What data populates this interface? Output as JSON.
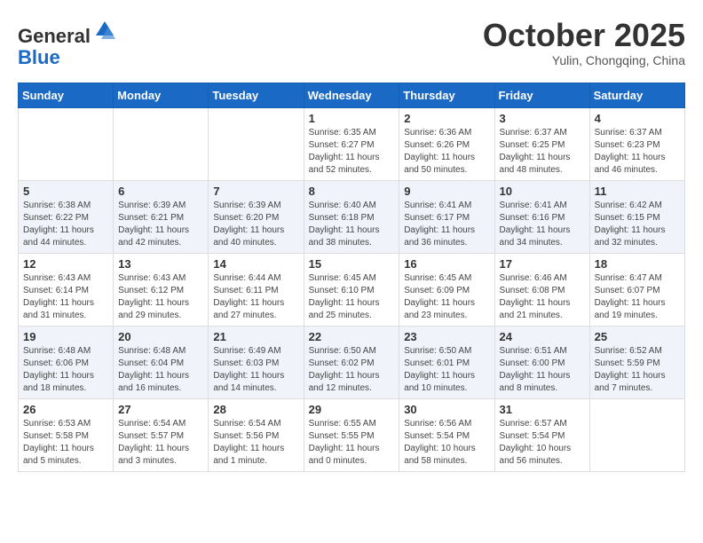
{
  "header": {
    "logo_line1": "General",
    "logo_line2": "Blue",
    "month": "October 2025",
    "location": "Yulin, Chongqing, China"
  },
  "weekdays": [
    "Sunday",
    "Monday",
    "Tuesday",
    "Wednesday",
    "Thursday",
    "Friday",
    "Saturday"
  ],
  "weeks": [
    [
      {
        "day": "",
        "info": ""
      },
      {
        "day": "",
        "info": ""
      },
      {
        "day": "",
        "info": ""
      },
      {
        "day": "1",
        "info": "Sunrise: 6:35 AM\nSunset: 6:27 PM\nDaylight: 11 hours\nand 52 minutes."
      },
      {
        "day": "2",
        "info": "Sunrise: 6:36 AM\nSunset: 6:26 PM\nDaylight: 11 hours\nand 50 minutes."
      },
      {
        "day": "3",
        "info": "Sunrise: 6:37 AM\nSunset: 6:25 PM\nDaylight: 11 hours\nand 48 minutes."
      },
      {
        "day": "4",
        "info": "Sunrise: 6:37 AM\nSunset: 6:23 PM\nDaylight: 11 hours\nand 46 minutes."
      }
    ],
    [
      {
        "day": "5",
        "info": "Sunrise: 6:38 AM\nSunset: 6:22 PM\nDaylight: 11 hours\nand 44 minutes."
      },
      {
        "day": "6",
        "info": "Sunrise: 6:39 AM\nSunset: 6:21 PM\nDaylight: 11 hours\nand 42 minutes."
      },
      {
        "day": "7",
        "info": "Sunrise: 6:39 AM\nSunset: 6:20 PM\nDaylight: 11 hours\nand 40 minutes."
      },
      {
        "day": "8",
        "info": "Sunrise: 6:40 AM\nSunset: 6:18 PM\nDaylight: 11 hours\nand 38 minutes."
      },
      {
        "day": "9",
        "info": "Sunrise: 6:41 AM\nSunset: 6:17 PM\nDaylight: 11 hours\nand 36 minutes."
      },
      {
        "day": "10",
        "info": "Sunrise: 6:41 AM\nSunset: 6:16 PM\nDaylight: 11 hours\nand 34 minutes."
      },
      {
        "day": "11",
        "info": "Sunrise: 6:42 AM\nSunset: 6:15 PM\nDaylight: 11 hours\nand 32 minutes."
      }
    ],
    [
      {
        "day": "12",
        "info": "Sunrise: 6:43 AM\nSunset: 6:14 PM\nDaylight: 11 hours\nand 31 minutes."
      },
      {
        "day": "13",
        "info": "Sunrise: 6:43 AM\nSunset: 6:12 PM\nDaylight: 11 hours\nand 29 minutes."
      },
      {
        "day": "14",
        "info": "Sunrise: 6:44 AM\nSunset: 6:11 PM\nDaylight: 11 hours\nand 27 minutes."
      },
      {
        "day": "15",
        "info": "Sunrise: 6:45 AM\nSunset: 6:10 PM\nDaylight: 11 hours\nand 25 minutes."
      },
      {
        "day": "16",
        "info": "Sunrise: 6:45 AM\nSunset: 6:09 PM\nDaylight: 11 hours\nand 23 minutes."
      },
      {
        "day": "17",
        "info": "Sunrise: 6:46 AM\nSunset: 6:08 PM\nDaylight: 11 hours\nand 21 minutes."
      },
      {
        "day": "18",
        "info": "Sunrise: 6:47 AM\nSunset: 6:07 PM\nDaylight: 11 hours\nand 19 minutes."
      }
    ],
    [
      {
        "day": "19",
        "info": "Sunrise: 6:48 AM\nSunset: 6:06 PM\nDaylight: 11 hours\nand 18 minutes."
      },
      {
        "day": "20",
        "info": "Sunrise: 6:48 AM\nSunset: 6:04 PM\nDaylight: 11 hours\nand 16 minutes."
      },
      {
        "day": "21",
        "info": "Sunrise: 6:49 AM\nSunset: 6:03 PM\nDaylight: 11 hours\nand 14 minutes."
      },
      {
        "day": "22",
        "info": "Sunrise: 6:50 AM\nSunset: 6:02 PM\nDaylight: 11 hours\nand 12 minutes."
      },
      {
        "day": "23",
        "info": "Sunrise: 6:50 AM\nSunset: 6:01 PM\nDaylight: 11 hours\nand 10 minutes."
      },
      {
        "day": "24",
        "info": "Sunrise: 6:51 AM\nSunset: 6:00 PM\nDaylight: 11 hours\nand 8 minutes."
      },
      {
        "day": "25",
        "info": "Sunrise: 6:52 AM\nSunset: 5:59 PM\nDaylight: 11 hours\nand 7 minutes."
      }
    ],
    [
      {
        "day": "26",
        "info": "Sunrise: 6:53 AM\nSunset: 5:58 PM\nDaylight: 11 hours\nand 5 minutes."
      },
      {
        "day": "27",
        "info": "Sunrise: 6:54 AM\nSunset: 5:57 PM\nDaylight: 11 hours\nand 3 minutes."
      },
      {
        "day": "28",
        "info": "Sunrise: 6:54 AM\nSunset: 5:56 PM\nDaylight: 11 hours\nand 1 minute."
      },
      {
        "day": "29",
        "info": "Sunrise: 6:55 AM\nSunset: 5:55 PM\nDaylight: 11 hours\nand 0 minutes."
      },
      {
        "day": "30",
        "info": "Sunrise: 6:56 AM\nSunset: 5:54 PM\nDaylight: 10 hours\nand 58 minutes."
      },
      {
        "day": "31",
        "info": "Sunrise: 6:57 AM\nSunset: 5:54 PM\nDaylight: 10 hours\nand 56 minutes."
      },
      {
        "day": "",
        "info": ""
      }
    ]
  ]
}
